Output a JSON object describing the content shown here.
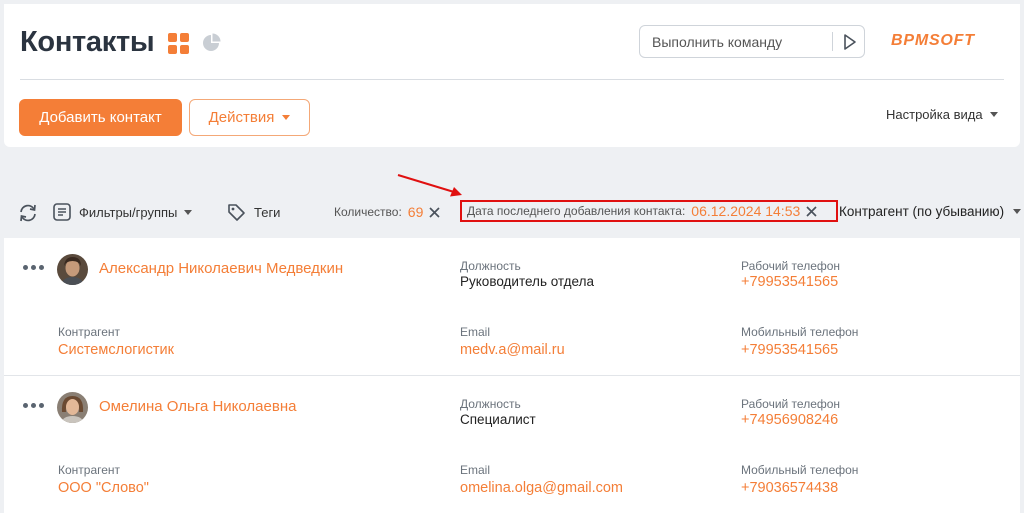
{
  "header": {
    "title": "Контакты",
    "command_placeholder": "Выполнить команду",
    "brand": "BPMSOFT",
    "add_button": "Добавить контакт",
    "actions_button": "Действия",
    "view_settings": "Настройка вида"
  },
  "toolbar": {
    "filters_label": "Фильтры/группы",
    "tags_label": "Теги",
    "count_label": "Количество:",
    "count_value": "69",
    "date_label": "Дата последнего добавления контакта:",
    "date_value": "06.12.2024 14:53",
    "sort_label": "Контрагент (по убыванию)"
  },
  "contacts": [
    {
      "name": "Александр Николаевич Медведкин",
      "position_label": "Должность",
      "position": "Руководитель отдела",
      "work_phone_label": "Рабочий телефон",
      "work_phone": "+79953541565",
      "account_label": "Контрагент",
      "account": "Системслогистик",
      "email_label": "Email",
      "email": "medv.a@mail.ru",
      "mobile_label": "Мобильный телефон",
      "mobile": "+79953541565"
    },
    {
      "name": "Омелина Ольга Николаевна",
      "position_label": "Должность",
      "position": "Специалист",
      "work_phone_label": "Рабочий телефон",
      "work_phone": "+74956908246",
      "account_label": "Контрагент",
      "account": "ООО \"Слово\"",
      "email_label": "Email",
      "email": "omelina.olga@gmail.com",
      "mobile_label": "Мобильный телефон",
      "mobile": "+79036574438"
    }
  ],
  "colors": {
    "accent": "#f47e37",
    "highlight_border": "#e01010",
    "background": "#eef0f3"
  },
  "icons": [
    "grid-view-icon",
    "chart-view-icon",
    "play-icon",
    "refresh-icon",
    "filter-icon",
    "tag-icon",
    "close-icon",
    "more-icon",
    "avatar"
  ]
}
